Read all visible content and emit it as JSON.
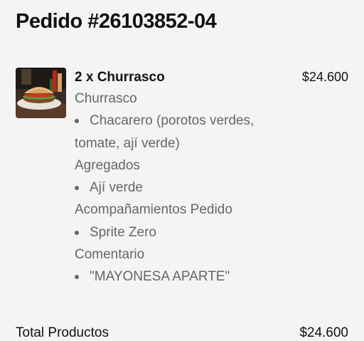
{
  "order": {
    "title": "Pedido #26103852-04"
  },
  "item": {
    "image": "churrasco-sandwich-photo",
    "name": "2 x Churrasco",
    "price": "$24.600",
    "sections": {
      "s1_title": "Churrasco",
      "s1_bullet_a": "Chacarero (porotos verdes,",
      "s1_bullet_b": "tomate, ají verde)",
      "s2_title": "Agregados",
      "s2_bullet": "Ají verde",
      "s3_title": "Acompañamientos Pedido",
      "s3_bullet": "Sprite Zero",
      "s4_title": "Comentario",
      "s4_bullet": "\"MAYONESA APARTE\""
    }
  },
  "summary": {
    "label": "Total Productos",
    "value": "$24.600"
  }
}
